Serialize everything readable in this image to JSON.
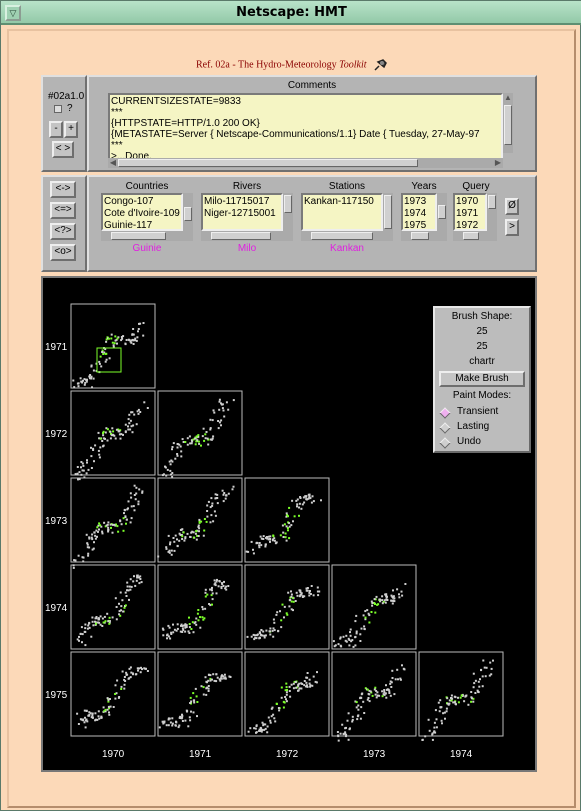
{
  "window": {
    "title": "Netscape: HMT"
  },
  "header": {
    "ref": "Ref. 02a",
    "sep": " - ",
    "title_main": "The Hydro-Meteorology",
    "title_italic": "Toolkit"
  },
  "left_panel": {
    "id_label": "#02a1.0",
    "q_label": "?",
    "minus": "-",
    "plus": "+",
    "arrows": "< >"
  },
  "comments": {
    "label": "Comments",
    "lines": [
      "CURRENTSIZESTATE=9833",
      "***",
      "{HTTPSTATE=HTTP/1.0 200 OK}",
      "{METASTATE=Server { Netscape-Communications/1.1} Date { Tuesday, 27-May-97",
      "***",
      ">...Done."
    ]
  },
  "side_buttons": [
    "<->",
    "<=>",
    "<?>",
    "<o>"
  ],
  "selectors": [
    {
      "label": "Countries",
      "items": [
        "Congo-107",
        "Cote d'Ivoire-109",
        "Guinie-117"
      ],
      "selected": "Guinie"
    },
    {
      "label": "Rivers",
      "items": [
        "Milo-11715017",
        "Niger-12715001"
      ],
      "selected": "Milo"
    },
    {
      "label": "Stations",
      "items": [
        "Kankan-117150"
      ],
      "selected": "Kankan"
    },
    {
      "label": "Years",
      "items": [
        "1973",
        "1974",
        "1975"
      ],
      "selected": ""
    },
    {
      "label": "Query",
      "items": [
        "1970",
        "1971",
        "1972"
      ],
      "selected": ""
    }
  ],
  "query_buttons": [
    "Ø",
    ">"
  ],
  "scatter_matrix": {
    "row_labels": [
      "1971",
      "1972",
      "1973",
      "1974",
      "1975"
    ],
    "col_labels": [
      "1970",
      "1971",
      "1972",
      "1973",
      "1974"
    ],
    "colors": {
      "point": "#cfcfcf",
      "highlight": "#7cff2a",
      "brush": "#7cff2a"
    }
  },
  "brush_panel": {
    "shape_label": "Brush Shape:",
    "width": "25",
    "height": "25",
    "mode": "chartr",
    "make_button": "Make Brush",
    "paint_label": "Paint Modes:",
    "modes": [
      "Transient",
      "Lasting",
      "Undo"
    ],
    "active_mode": "Transient"
  }
}
